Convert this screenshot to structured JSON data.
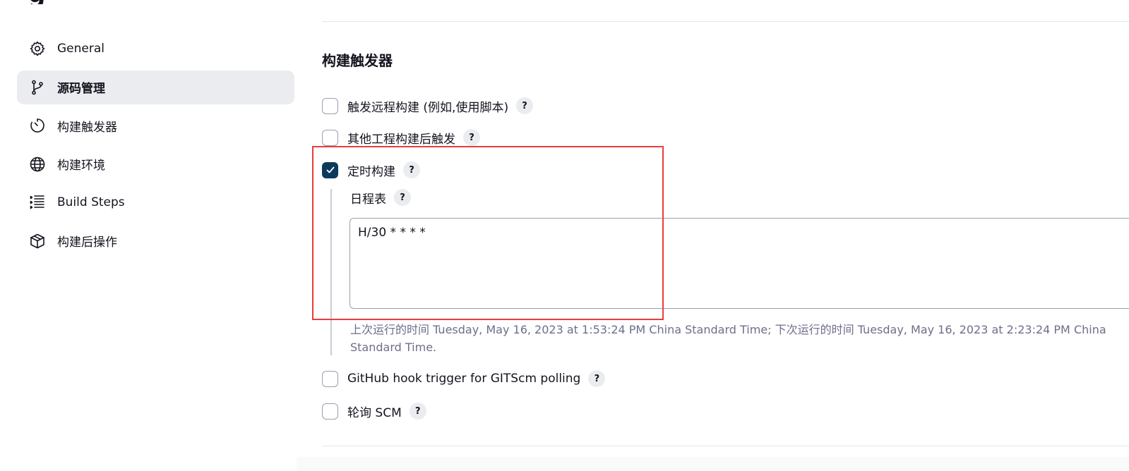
{
  "page_title_fragment": "g",
  "sidebar": {
    "items": [
      {
        "label": "General",
        "icon": "gear-icon",
        "active": false
      },
      {
        "label": "源码管理",
        "icon": "source-branch-icon",
        "active": true
      },
      {
        "label": "构建触发器",
        "icon": "timer-icon",
        "active": false
      },
      {
        "label": "构建环境",
        "icon": "globe-icon",
        "active": false
      },
      {
        "label": "Build Steps",
        "icon": "list-steps-icon",
        "active": false
      },
      {
        "label": "构建后操作",
        "icon": "package-icon",
        "active": false
      }
    ]
  },
  "triggers": {
    "section_title": "构建触发器",
    "options": [
      {
        "label": "触发远程构建 (例如,使用脚本)",
        "checked": false,
        "help": "?"
      },
      {
        "label": "其他工程构建后触发",
        "checked": false,
        "help": "?"
      },
      {
        "label": "定时构建",
        "checked": true,
        "help": "?"
      },
      {
        "label": "GitHub hook trigger for GITScm polling",
        "checked": false,
        "help": "?"
      },
      {
        "label": "轮询 SCM",
        "checked": false,
        "help": "?"
      }
    ],
    "schedule": {
      "label": "日程表",
      "help": "?",
      "value": "H/30 * * * *",
      "info": "上次运行的时间 Tuesday, May 16, 2023 at 1:53:24 PM China Standard Time; 下次运行的时间 Tuesday, May 16, 2023 at 2:23:24 PM China Standard Time."
    }
  },
  "colors": {
    "accent": "#0b3a5c",
    "highlight_box": "#e83d3d",
    "active_nav_bg": "#ebecf0",
    "muted_text": "#6e6e8a"
  }
}
